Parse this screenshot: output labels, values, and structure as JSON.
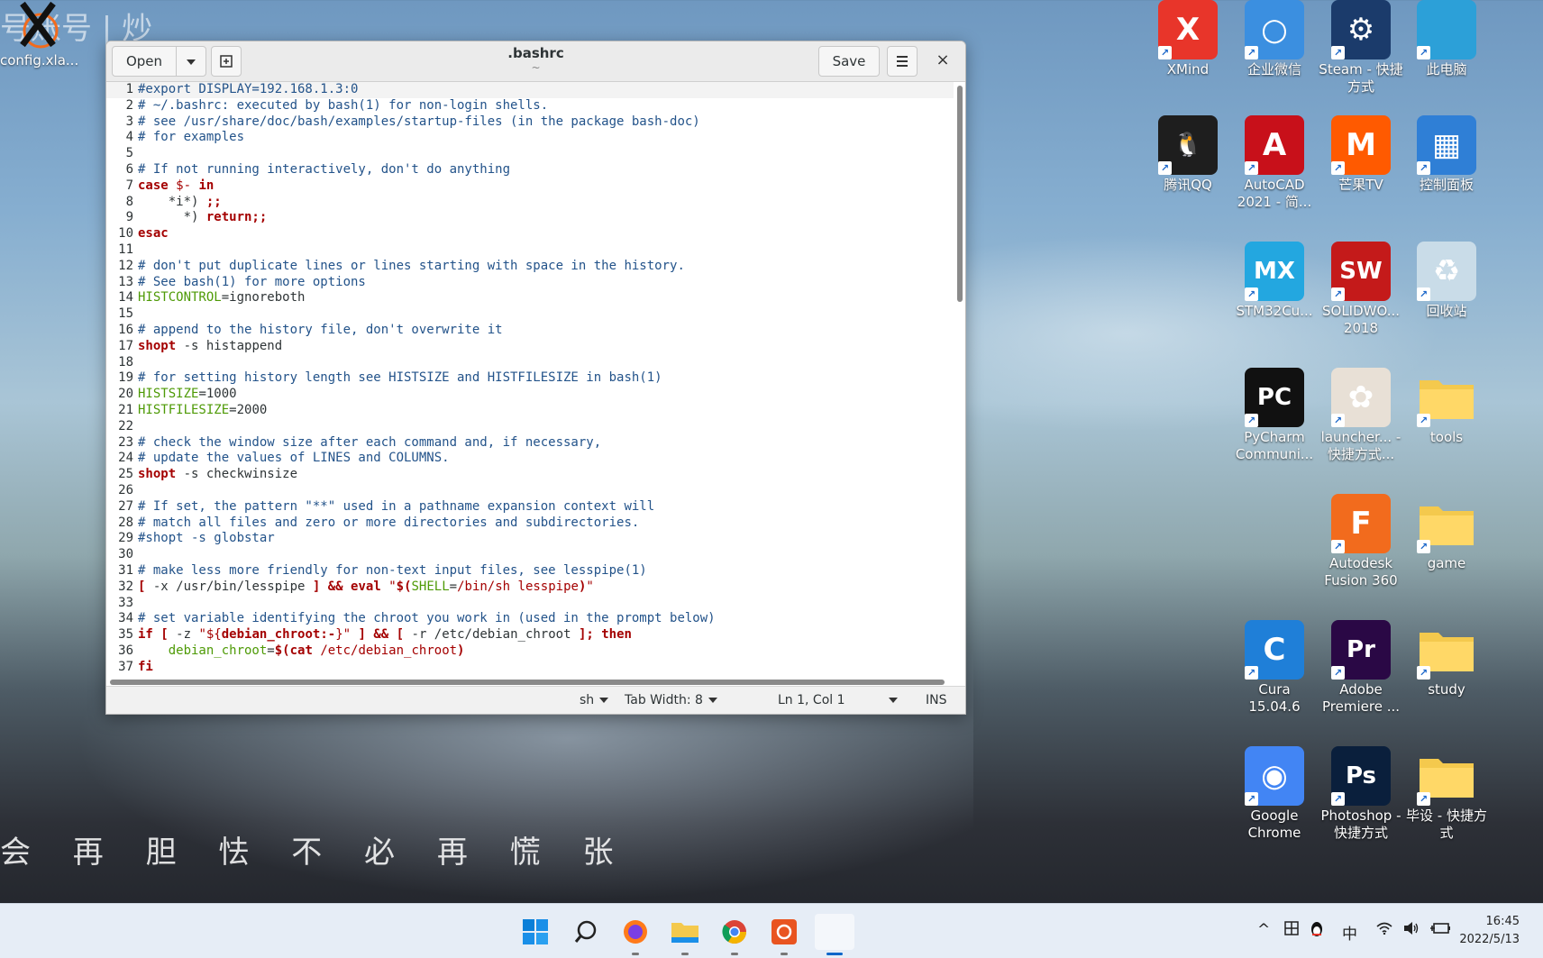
{
  "desktop": {
    "wallpaper_caption": "会 再 胆 怯   不 必 再 慌 张",
    "wallpaper_top_text": "号账号 | 炒",
    "top_left_item": {
      "label": "config.xla..."
    },
    "icons": [
      {
        "label": "XMind",
        "icon": "xmind-icon",
        "color": "#e8352a",
        "glyph": "X"
      },
      {
        "label": "企业微信",
        "icon": "wecom-icon",
        "color": "#3b8fe0",
        "glyph": "○"
      },
      {
        "label": "Steam - 快捷方式",
        "icon": "steam-icon",
        "color": "#1b3b6b",
        "glyph": "⚙"
      },
      {
        "label": "此电脑",
        "icon": "monitor-icon",
        "color": "#2ca0d8",
        "glyph": ""
      },
      {
        "label": "腾讯QQ",
        "icon": "qq-penguin-icon",
        "color": "#1e1e1e",
        "glyph": "🐧"
      },
      {
        "label": "AutoCAD 2021 - 简...",
        "icon": "autocad-icon",
        "color": "#c8101a",
        "glyph": "A"
      },
      {
        "label": "芒果TV",
        "icon": "mango-tv-icon",
        "color": "#ff5a00",
        "glyph": "M"
      },
      {
        "label": "控制面板",
        "icon": "control-panel-icon",
        "color": "#2f7fd6",
        "glyph": "▦"
      },
      {
        "label": "STM32Cu...",
        "icon": "stm32-icon",
        "color": "#23a7e0",
        "glyph": "MX"
      },
      {
        "label": "SOLIDWO... 2018",
        "icon": "solidworks-icon",
        "color": "#c41a1a",
        "glyph": "SW"
      },
      {
        "label": "回收站",
        "icon": "recycle-bin-icon",
        "color": "#c9dce8",
        "glyph": "♻"
      },
      {
        "label": "PyCharm Communi...",
        "icon": "pycharm-icon",
        "color": "#111111",
        "glyph": "PC"
      },
      {
        "label": "launcher... - 快捷方式...",
        "icon": "launcher-icon",
        "color": "#e8e0d6",
        "glyph": "✿"
      },
      {
        "label": "tools",
        "icon": "folder-icon",
        "color": "#f4c94d",
        "glyph": ""
      },
      {
        "label": "Autodesk Fusion 360",
        "icon": "fusion360-icon",
        "color": "#f26b1d",
        "glyph": "F"
      },
      {
        "label": "game",
        "icon": "folder-icon",
        "color": "#f4c94d",
        "glyph": ""
      },
      {
        "label": "Cura 15.04.6",
        "icon": "cura-icon",
        "color": "#1f7fd8",
        "glyph": "C"
      },
      {
        "label": "Adobe Premiere ...",
        "icon": "premiere-icon",
        "color": "#2a0845",
        "glyph": "Pr"
      },
      {
        "label": "study",
        "icon": "folder-icon",
        "color": "#f4c94d",
        "glyph": ""
      },
      {
        "label": "Google Chrome",
        "icon": "chrome-icon",
        "color": "#4285f4",
        "glyph": "◉"
      },
      {
        "label": "Photoshop - 快捷方式",
        "icon": "photoshop-icon",
        "color": "#0a1f3c",
        "glyph": "Ps"
      },
      {
        "label": "毕设 - 快捷方式",
        "icon": "folder-icon",
        "color": "#f4c94d",
        "glyph": ""
      }
    ]
  },
  "editor": {
    "title": ".bashrc",
    "subtitle": "~",
    "open_label": "Open",
    "save_label": "Save",
    "close_glyph": "×",
    "status": {
      "language": "sh",
      "tab_width": "Tab Width: 8",
      "position": "Ln 1, Col 1",
      "mode": "INS"
    },
    "lines": [
      {
        "n": "1",
        "html": "<span class='c'>#export DISPLAY=192.168.1.3:0</span>"
      },
      {
        "n": "2",
        "html": "<span class='c'># ~/.bashrc: executed by bash(1) for non-login shells.</span>"
      },
      {
        "n": "3",
        "html": "<span class='c'># see /usr/share/doc/bash/examples/startup-files (in the package bash-doc)</span>"
      },
      {
        "n": "4",
        "html": "<span class='c'># for examples</span>"
      },
      {
        "n": "5",
        "html": ""
      },
      {
        "n": "6",
        "html": "<span class='c'># If not running interactively, don't do anything</span>"
      },
      {
        "n": "7",
        "html": "<span class='k'>case</span> <span class='s'>$-</span> <span class='k'>in</span>"
      },
      {
        "n": "8",
        "html": "    *i*) <span class='k'>;;</span>"
      },
      {
        "n": "9",
        "html": "      *) <span class='k'>return;;</span>"
      },
      {
        "n": "10",
        "html": "<span class='k'>esac</span>"
      },
      {
        "n": "11",
        "html": ""
      },
      {
        "n": "12",
        "html": "<span class='c'># don't put duplicate lines or lines starting with space in the history.</span>"
      },
      {
        "n": "13",
        "html": "<span class='c'># See bash(1) for more options</span>"
      },
      {
        "n": "14",
        "html": "<span class='v'>HISTCONTROL</span>=ignoreboth"
      },
      {
        "n": "15",
        "html": ""
      },
      {
        "n": "16",
        "html": "<span class='c'># append to the history file, don't overwrite it</span>"
      },
      {
        "n": "17",
        "html": "<span class='k'>shopt</span> -s histappend"
      },
      {
        "n": "18",
        "html": ""
      },
      {
        "n": "19",
        "html": "<span class='c'># for setting history length see HISTSIZE and HISTFILESIZE in bash(1)</span>"
      },
      {
        "n": "20",
        "html": "<span class='v'>HISTSIZE</span>=1000"
      },
      {
        "n": "21",
        "html": "<span class='v'>HISTFILESIZE</span>=2000"
      },
      {
        "n": "22",
        "html": ""
      },
      {
        "n": "23",
        "html": "<span class='c'># check the window size after each command and, if necessary,</span>"
      },
      {
        "n": "24",
        "html": "<span class='c'># update the values of LINES and COLUMNS.</span>"
      },
      {
        "n": "25",
        "html": "<span class='k'>shopt</span> -s checkwinsize"
      },
      {
        "n": "26",
        "html": ""
      },
      {
        "n": "27",
        "html": "<span class='c'># If set, the pattern \"**\" used in a pathname expansion context will</span>"
      },
      {
        "n": "28",
        "html": "<span class='c'># match all files and zero or more directories and subdirectories.</span>"
      },
      {
        "n": "29",
        "html": "<span class='c'>#shopt -s globstar</span>"
      },
      {
        "n": "30",
        "html": ""
      },
      {
        "n": "31",
        "html": "<span class='c'># make less more friendly for non-text input files, see lesspipe(1)</span>"
      },
      {
        "n": "32",
        "html": "<span class='k'>[</span> -x /usr/bin/lesspipe <span class='k'>]</span> <span class='k'>&amp;&amp;</span> <span class='k'>eval</span> <span class='s'>\"</span><span class='k'>$(</span><span class='v'>SHELL</span>=<span class='s'>/bin/sh lesspipe</span><span class='k'>)</span><span class='s'>\"</span>"
      },
      {
        "n": "33",
        "html": ""
      },
      {
        "n": "34",
        "html": "<span class='c'># set variable identifying the chroot you work in (used in the prompt below)</span>"
      },
      {
        "n": "35",
        "html": "<span class='k'>if</span> <span class='k'>[</span> -z <span class='s'>\"${</span><span class='k'>debian_chroot:-</span><span class='s'>}\"</span> <span class='k'>]</span> <span class='k'>&amp;&amp;</span> <span class='k'>[</span> -r /etc/debian_chroot <span class='k'>]; then</span>"
      },
      {
        "n": "36",
        "html": "    <span class='v'>debian_chroot</span>=<span class='k'>$(cat</span> <span class='s'>/etc/debian_chroot</span><span class='k'>)</span>"
      },
      {
        "n": "37",
        "html": "<span class='k'>fi</span>"
      }
    ]
  },
  "taskbar": {
    "apps": [
      "windows-start-icon",
      "search-icon",
      "firefox-icon",
      "file-explorer-icon",
      "chrome-icon",
      "ubuntu-icon",
      "active-window-icon"
    ],
    "tray": {
      "chevron": "^",
      "ime": "中"
    },
    "time": "16:45",
    "date": "2022/5/13"
  }
}
